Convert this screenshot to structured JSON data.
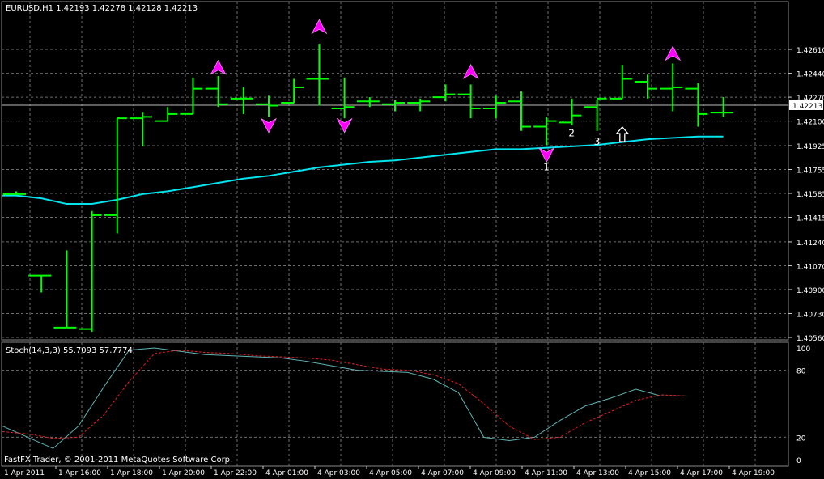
{
  "chart_data": [
    {
      "type": "bar",
      "subtype": "ohlc",
      "title": "EURUSD,H1  1.42193 1.42278 1.42128 1.42213",
      "ylim": [
        1.4056,
        1.4276
      ],
      "price_ticks": [
        "1.42610",
        "1.42440",
        "1.42270",
        "1.42100",
        "1.41925",
        "1.41755",
        "1.41585",
        "1.41415",
        "1.41240",
        "1.41070",
        "1.40900",
        "1.40730",
        "1.40560"
      ],
      "current_price": "1.42213",
      "bars": [
        {
          "o": 1.4158,
          "h": 1.416,
          "l": 1.4158,
          "c": 1.4158
        },
        {
          "o": 1.41,
          "h": 1.41,
          "l": 1.4088,
          "c": 1.41
        },
        {
          "o": 1.4063,
          "h": 1.4118,
          "l": 1.4063,
          "c": 1.4063
        },
        {
          "o": 1.4062,
          "h": 1.4146,
          "l": 1.406,
          "c": 1.4143
        },
        {
          "o": 1.4143,
          "h": 1.4212,
          "l": 1.413,
          "c": 1.4212
        },
        {
          "o": 1.4212,
          "h": 1.4216,
          "l": 1.4192,
          "c": 1.4213
        },
        {
          "o": 1.421,
          "h": 1.422,
          "l": 1.421,
          "c": 1.4215
        },
        {
          "o": 1.4215,
          "h": 1.4241,
          "l": 1.4215,
          "c": 1.4233
        },
        {
          "o": 1.4233,
          "h": 1.4242,
          "l": 1.422,
          "c": 1.4222
        },
        {
          "o": 1.4226,
          "h": 1.4234,
          "l": 1.4215,
          "c": 1.4226
        },
        {
          "o": 1.4222,
          "h": 1.4228,
          "l": 1.4213,
          "c": 1.4221
        },
        {
          "o": 1.4223,
          "h": 1.424,
          "l": 1.4223,
          "c": 1.4234
        },
        {
          "o": 1.424,
          "h": 1.4265,
          "l": 1.4221,
          "c": 1.424
        },
        {
          "o": 1.4219,
          "h": 1.4241,
          "l": 1.4212,
          "c": 1.422
        },
        {
          "o": 1.4224,
          "h": 1.4227,
          "l": 1.422,
          "c": 1.4224
        },
        {
          "o": 1.4222,
          "h": 1.4225,
          "l": 1.4217,
          "c": 1.4223
        },
        {
          "o": 1.4223,
          "h": 1.4226,
          "l": 1.4217,
          "c": 1.4224
        },
        {
          "o": 1.4227,
          "h": 1.4236,
          "l": 1.4224,
          "c": 1.4229
        },
        {
          "o": 1.4229,
          "h": 1.4236,
          "l": 1.4212,
          "c": 1.4219
        },
        {
          "o": 1.4219,
          "h": 1.4228,
          "l": 1.4212,
          "c": 1.4223
        },
        {
          "o": 1.4224,
          "h": 1.4231,
          "l": 1.4203,
          "c": 1.4206
        },
        {
          "o": 1.4206,
          "h": 1.4213,
          "l": 1.4193,
          "c": 1.421
        },
        {
          "o": 1.4209,
          "h": 1.4226,
          "l": 1.4207,
          "c": 1.4214
        },
        {
          "o": 1.422,
          "h": 1.4225,
          "l": 1.4203,
          "c": 1.4226
        },
        {
          "o": 1.4226,
          "h": 1.425,
          "l": 1.4226,
          "c": 1.424
        },
        {
          "o": 1.4238,
          "h": 1.4243,
          "l": 1.4226,
          "c": 1.4233
        },
        {
          "o": 1.4233,
          "h": 1.4251,
          "l": 1.4217,
          "c": 1.4234
        },
        {
          "o": 1.4233,
          "h": 1.4237,
          "l": 1.4206,
          "c": 1.4215
        },
        {
          "o": 1.4216,
          "h": 1.4227,
          "l": 1.4213,
          "c": 1.4216
        }
      ],
      "ma_values": [
        1.4157,
        1.4155,
        1.4151,
        1.4151,
        1.4154,
        1.4158,
        1.416,
        1.4163,
        1.4166,
        1.4169,
        1.4171,
        1.4174,
        1.4177,
        1.4179,
        1.4181,
        1.4182,
        1.4184,
        1.4186,
        1.4188,
        1.419,
        1.419,
        1.4191,
        1.4192,
        1.4193,
        1.4195,
        1.4197,
        1.4198,
        1.4199,
        1.4199
      ],
      "up_arrows": [
        {
          "i": 8,
          "y": 1.4248
        },
        {
          "i": 12,
          "y": 1.4277
        },
        {
          "i": 18,
          "y": 1.4245
        },
        {
          "i": 26,
          "y": 1.4258
        }
      ],
      "down_arrows": [
        {
          "i": 10,
          "y": 1.4207
        },
        {
          "i": 13,
          "y": 1.4207
        },
        {
          "i": 21,
          "y": 1.4186
        }
      ],
      "annotations": [
        {
          "text": "1",
          "i": 21,
          "y": 1.4175
        },
        {
          "text": "2",
          "i": 22,
          "y": 1.4199
        },
        {
          "text": "3",
          "i": 23,
          "y": 1.4193
        }
      ],
      "outline_arrow": {
        "i": 24,
        "y": 1.42
      }
    },
    {
      "type": "line",
      "title": "Stoch(14,3,3) 55.7093 57.7774",
      "ylim": [
        0,
        100
      ],
      "levels": [
        20,
        80
      ],
      "y_ticks": [
        "100",
        "80",
        "20",
        "0"
      ],
      "series": [
        {
          "color": "#5fb4b4",
          "values": [
            30,
            20,
            10,
            30,
            65,
            98,
            100,
            97,
            94,
            93,
            92,
            91,
            88,
            84,
            80,
            79,
            78,
            72,
            60,
            20,
            17,
            20,
            35,
            48,
            55,
            63,
            57,
            57
          ]
        },
        {
          "color": "#e02020",
          "values": [
            25,
            23,
            19,
            20,
            40,
            70,
            95,
            98,
            96,
            95,
            93,
            92,
            91,
            89,
            85,
            81,
            80,
            76,
            68,
            50,
            30,
            18,
            20,
            33,
            43,
            53,
            58,
            57
          ]
        }
      ]
    }
  ],
  "x_labels": [
    "1 Apr 2011",
    "1 Apr 16:00",
    "1 Apr 18:00",
    "1 Apr 20:00",
    "1 Apr 22:00",
    "4 Apr 01:00",
    "4 Apr 03:00",
    "4 Apr 05:00",
    "4 Apr 07:00",
    "4 Apr 09:00",
    "4 Apr 11:00",
    "4 Apr 13:00",
    "4 Apr 15:00",
    "4 Apr 17:00",
    "4 Apr 19:00"
  ],
  "footer": "FastFX Trader, © 2001-2011 MetaQuotes Software Corp.",
  "colors": {
    "background": "#000000",
    "bar": "#00ff00",
    "ma": "#00e5ee",
    "arrow": "#ff00ff",
    "grid": "#6e6e6e",
    "text": "#ffffff"
  }
}
